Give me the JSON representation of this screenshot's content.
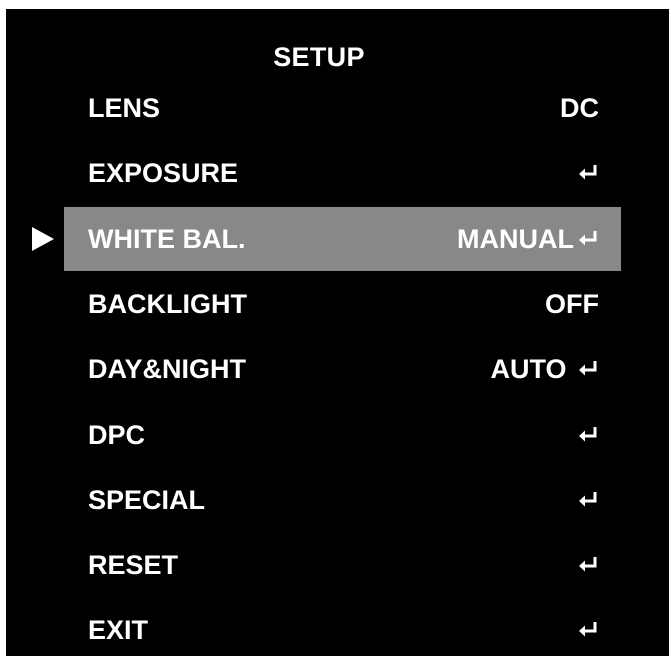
{
  "title": "SETUP",
  "menu": {
    "items": [
      {
        "label": "LENS",
        "value": "DC",
        "enter": false
      },
      {
        "label": "EXPOSURE",
        "value": "",
        "enter": true
      },
      {
        "label": "WHITE BAL.",
        "value": "MANUAL",
        "enter": true
      },
      {
        "label": "BACKLIGHT",
        "value": "OFF",
        "enter": false
      },
      {
        "label": "DAY&NIGHT",
        "value": "AUTO ",
        "enter": true
      },
      {
        "label": "DPC",
        "value": "",
        "enter": true
      },
      {
        "label": "SPECIAL",
        "value": "",
        "enter": true
      },
      {
        "label": "RESET",
        "value": "",
        "enter": true
      },
      {
        "label": "EXIT",
        "value": "",
        "enter": true
      }
    ],
    "selected_index": 2
  },
  "colors": {
    "background": "#000000",
    "text": "#ffffff",
    "highlight": "#888888"
  },
  "icons": {
    "enter": "enter-return-icon",
    "selector": "selector-arrow-icon"
  }
}
